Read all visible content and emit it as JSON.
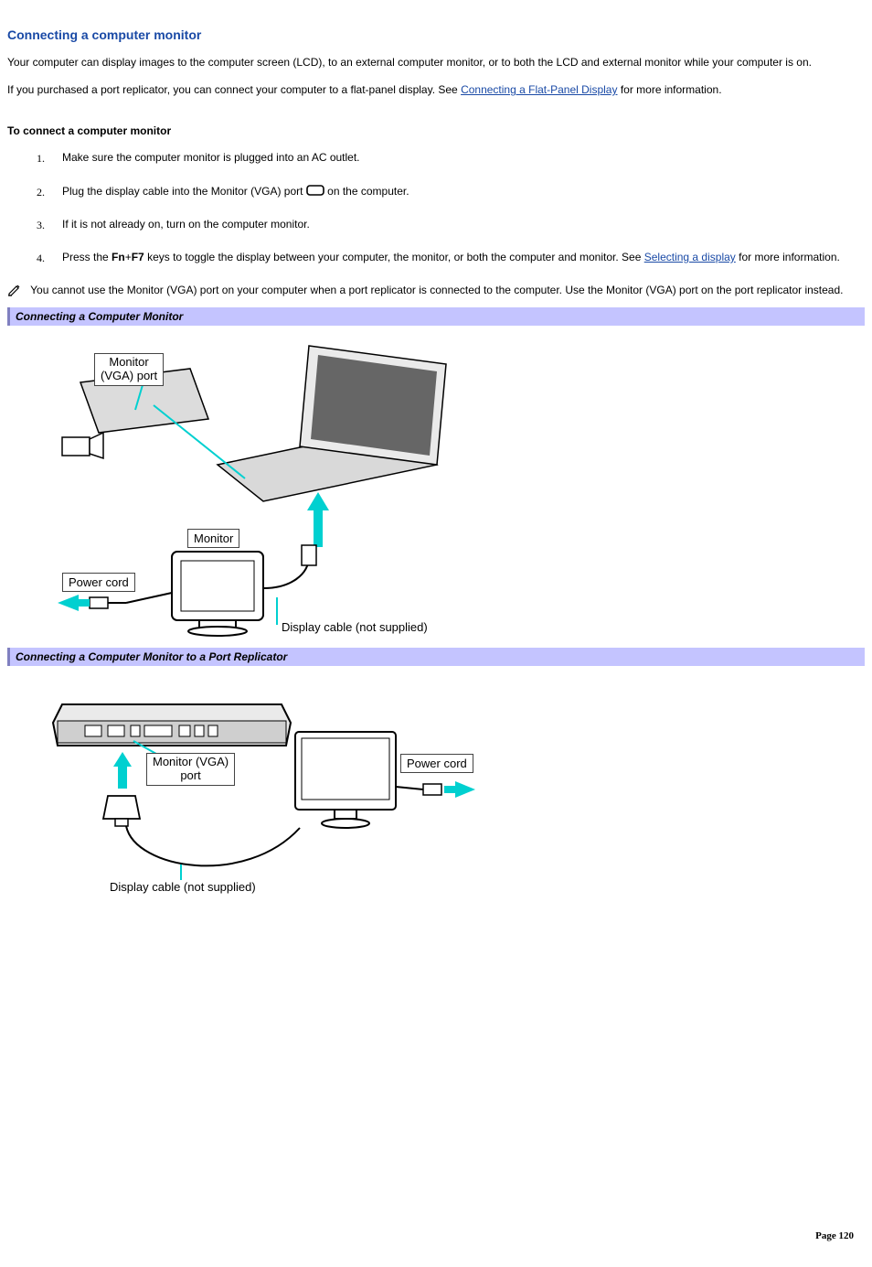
{
  "heading": "Connecting a computer monitor",
  "para1": "Your computer can display images to the computer screen (LCD), to an external computer monitor, or to both the LCD and external monitor while your computer is on.",
  "para2_pre": "If you purchased a port replicator, you can connect your computer to a flat-panel display. See ",
  "para2_link": "Connecting a Flat-Panel Display",
  "para2_post": " for more information.",
  "sub_heading": "To connect a computer monitor",
  "steps": {
    "s1": "Make sure the computer monitor is plugged into an AC outlet.",
    "s2_pre": "Plug the display cable into the Monitor (VGA) port ",
    "s2_post": " on the computer.",
    "s3": "If it is not already on, turn on the computer monitor.",
    "s4_pre": "Press the ",
    "s4_key1": "Fn",
    "s4_plus": "+",
    "s4_key2": "F7",
    "s4_mid": " keys to toggle the display between your computer, the monitor, or both the computer and monitor. See ",
    "s4_link": "Selecting a display",
    "s4_post": " for more information."
  },
  "note": "You cannot use the Monitor (VGA) port on your computer when a port replicator is connected to the computer. Use the Monitor (VGA) port on the port replicator instead.",
  "caption1": "Connecting a Computer Monitor",
  "fig1": {
    "label_vga": "Monitor\n(VGA) port",
    "label_power": "Power cord",
    "label_monitor": "Monitor",
    "label_cable": "Display cable (not supplied)"
  },
  "caption2": "Connecting a Computer Monitor to a Port Replicator",
  "fig2": {
    "label_vga": "Monitor (VGA)\nport",
    "label_power": "Power cord",
    "label_cable": "Display cable (not supplied)"
  },
  "page_number": "Page 120"
}
